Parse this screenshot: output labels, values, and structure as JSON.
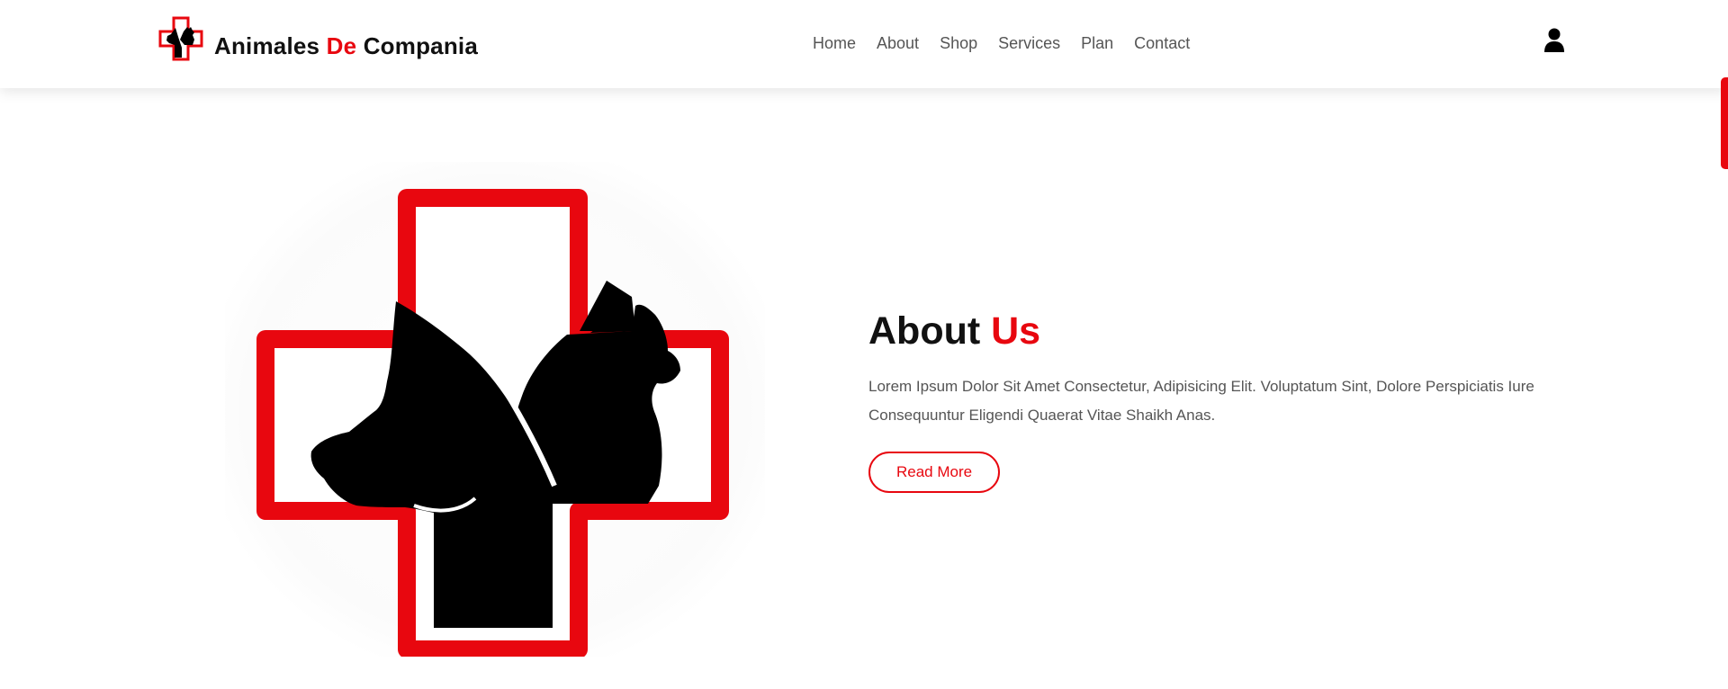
{
  "brand": {
    "name_part1": "Animales ",
    "name_accent": "De",
    "name_part2": " Compania",
    "logo_icon": "vet-cross-pets-logo-icon"
  },
  "nav": {
    "items": [
      {
        "label": "Home"
      },
      {
        "label": "About"
      },
      {
        "label": "Shop"
      },
      {
        "label": "Services"
      },
      {
        "label": "Plan"
      },
      {
        "label": "Contact"
      }
    ]
  },
  "header": {
    "user_icon": "user-icon"
  },
  "about": {
    "title_part1": "About ",
    "title_accent": "Us",
    "text": "Lorem Ipsum Dolor Sit Amet Consectetur, Adipisicing Elit. Voluptatum Sint, Dolore Perspiciatis Iure Consequuntur Eligendi Quaerat Vitae Shaikh Anas.",
    "button_label": "Read More",
    "image_icon": "vet-cross-dog-cat-image"
  },
  "colors": {
    "accent": "#e8070f",
    "text_dark": "#111111",
    "text_muted": "#555555"
  }
}
